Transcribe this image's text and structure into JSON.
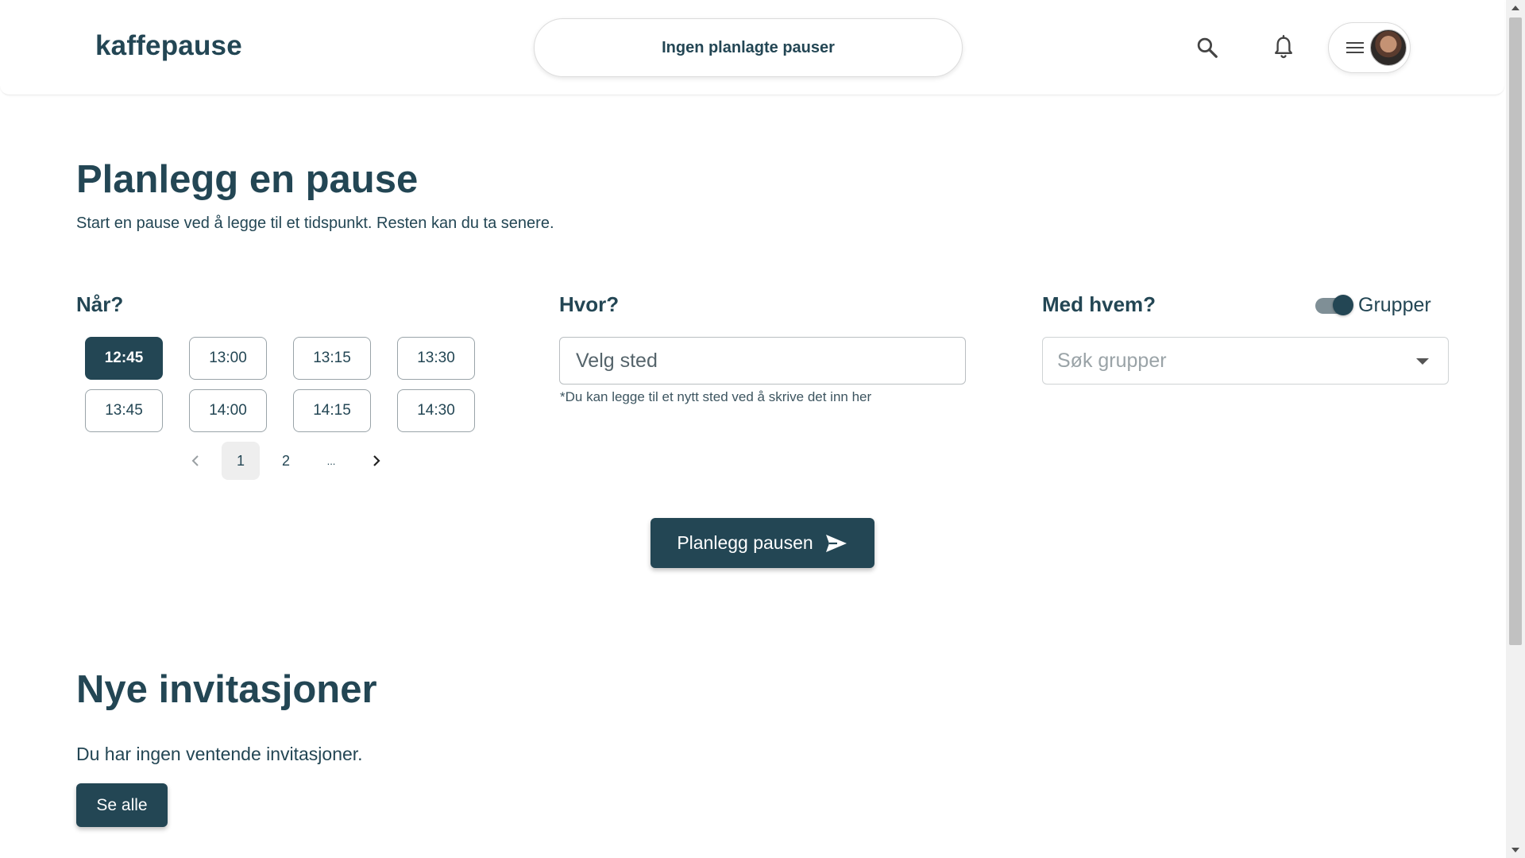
{
  "header": {
    "logo": "kaffepause",
    "status_pill": "Ingen planlagte pauser",
    "icons": {
      "search": "search-icon",
      "notifications": "bell-icon",
      "menu": "hamburger-menu-icon"
    }
  },
  "plan": {
    "title": "Planlegg en pause",
    "subtitle": "Start en pause ved å legge til et tidspunkt. Resten kan du ta senere.",
    "when": {
      "label": "Når?",
      "times": [
        "12:45",
        "13:00",
        "13:15",
        "13:30",
        "13:45",
        "14:00",
        "14:15",
        "14:30"
      ],
      "selected": "12:45",
      "pagination": {
        "pages": [
          "1",
          "2",
          "..."
        ],
        "current": "1"
      }
    },
    "where": {
      "label": "Hvor?",
      "placeholder": "Velg sted",
      "hint": "*Du kan legge til et nytt sted ved å skrive det inn her"
    },
    "with_whom": {
      "label": "Med hvem?",
      "toggle_label": "Grupper",
      "toggle_on": true,
      "placeholder": "Søk grupper"
    },
    "submit_label": "Planlegg pausen"
  },
  "invitations": {
    "title": "Nye invitasjoner",
    "empty_text": "Du har ingen ventende invitasjoner.",
    "see_all_label": "Se alle"
  },
  "colors": {
    "primary": "#234654",
    "border": "#9aa4a9",
    "page_bg": "#ffffff"
  }
}
